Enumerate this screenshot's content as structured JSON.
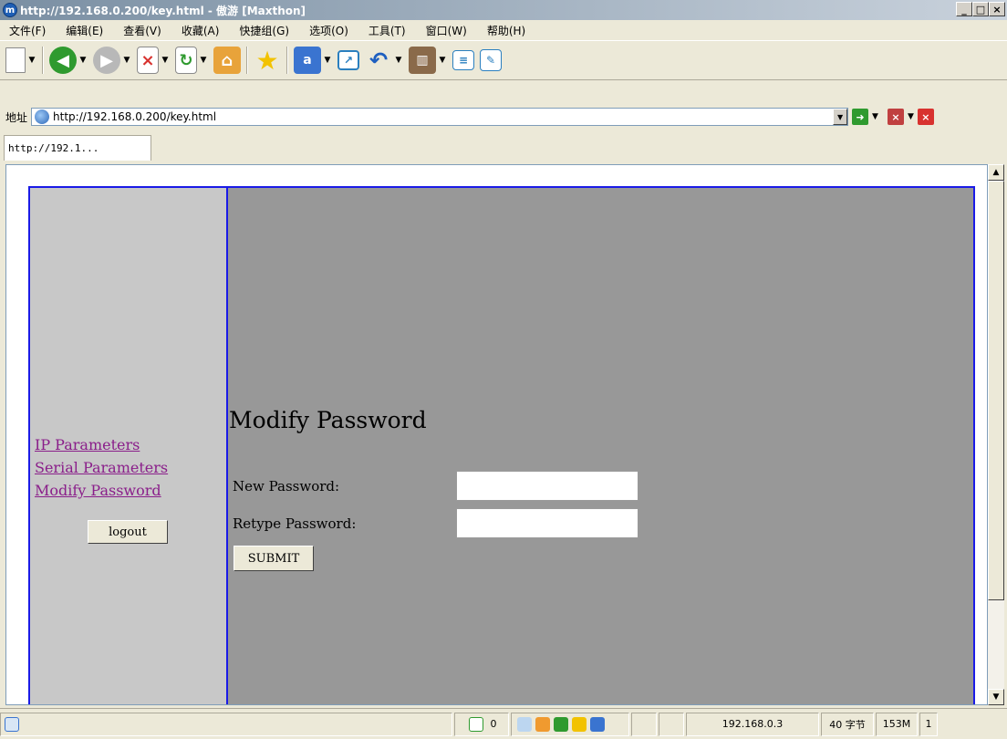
{
  "window": {
    "title": "http://192.168.0.200/key.html - 傲游 [Maxthon]",
    "app_icon": "m",
    "buttons": [
      "_",
      "□",
      "×"
    ]
  },
  "menu": [
    "文件(F)",
    "编辑(E)",
    "查看(V)",
    "收藏(A)",
    "快捷组(G)",
    "选项(O)",
    "工具(T)",
    "窗口(W)",
    "帮助(H)"
  ],
  "toolbar": {
    "icons": [
      "new-page-icon",
      "back-icon",
      "forward-icon",
      "stop-icon",
      "refresh-icon",
      "home-icon",
      "favorites-star-icon",
      "translate-icon",
      "capture-icon",
      "undo-icon",
      "tools-icon",
      "list-icon",
      "edit-icon"
    ]
  },
  "address": {
    "label": "地址",
    "url": "http://192.168.0.200/key.html"
  },
  "tabs": [
    {
      "label": "http://192.1..."
    }
  ],
  "page": {
    "nav": {
      "links": [
        "IP Parameters",
        "Serial Parameters",
        "Modify Password"
      ],
      "logout_label": "logout"
    },
    "form": {
      "title": "Modify Password",
      "new_password_label": "New Password:",
      "retype_password_label": "Retype Password:",
      "new_password_value": "",
      "retype_password_value": "",
      "submit_label": "SUBMIT"
    }
  },
  "status": {
    "counter": "0",
    "ip": "192.168.0.3",
    "bytes": "40 字节",
    "memory": "153M",
    "tab_count": "1"
  },
  "colors": {
    "frame_border": "#1a1ae6",
    "left_pane": "#c8c8c8",
    "right_pane": "#989898",
    "link": "#8a1e8a"
  }
}
